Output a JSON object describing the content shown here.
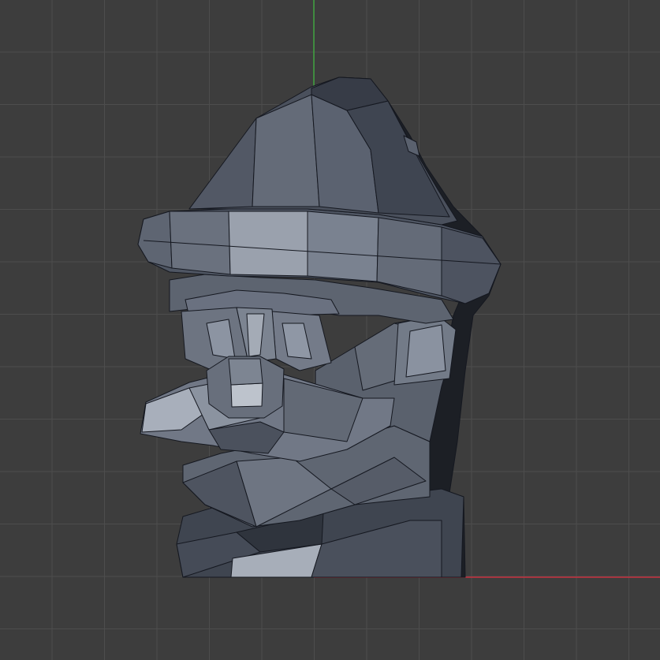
{
  "viewport": {
    "view": "front-orthographic",
    "grid": true,
    "axes": [
      "x",
      "y"
    ],
    "colors": {
      "background": "#3d3d3d",
      "grid_line": "#4d4d4d",
      "x_axis": "#c8313f",
      "y_axis": "#3fa33f",
      "mesh_edge": "#151820"
    }
  },
  "model": {
    "type": "low-poly character head",
    "parts": [
      "hat-cone",
      "hat-brim",
      "eyebrows",
      "eyes",
      "nose",
      "mustache",
      "chin",
      "ear",
      "neck"
    ]
  }
}
